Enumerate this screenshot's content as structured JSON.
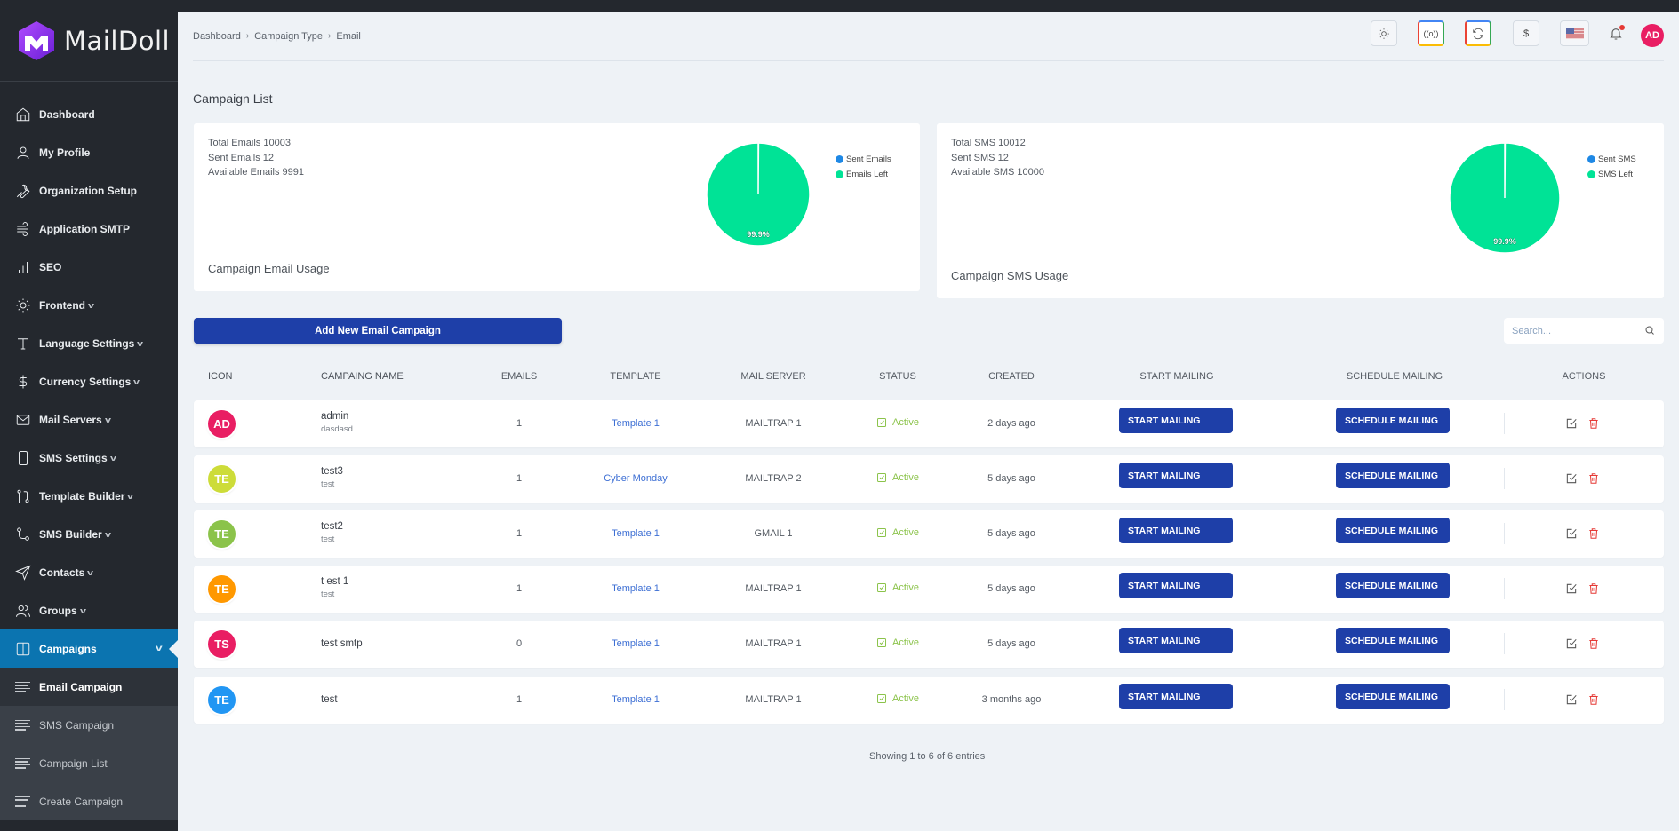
{
  "app": {
    "name": "MailDoll"
  },
  "sidebar": {
    "items": [
      {
        "label": "Dashboard",
        "icon": "home-icon",
        "has_submenu": false
      },
      {
        "label": "My Profile",
        "icon": "user-icon",
        "has_submenu": false
      },
      {
        "label": "Organization Setup",
        "icon": "wrench-icon",
        "has_submenu": false
      },
      {
        "label": "Application SMTP",
        "icon": "wind-icon",
        "has_submenu": false
      },
      {
        "label": "SEO",
        "icon": "bar-chart-icon",
        "has_submenu": false
      },
      {
        "label": "Frontend",
        "icon": "sun-icon",
        "has_submenu": true
      },
      {
        "label": "Language Settings",
        "icon": "type-icon",
        "has_submenu": true
      },
      {
        "label": "Currency Settings",
        "icon": "dollar-icon",
        "has_submenu": true
      },
      {
        "label": "Mail Servers",
        "icon": "mail-icon",
        "has_submenu": true
      },
      {
        "label": "SMS Settings",
        "icon": "phone-icon",
        "has_submenu": true
      },
      {
        "label": "Template Builder",
        "icon": "git-pull-icon",
        "has_submenu": true
      },
      {
        "label": "SMS Builder",
        "icon": "git-merge-icon",
        "has_submenu": true
      },
      {
        "label": "Contacts",
        "icon": "send-icon",
        "has_submenu": true
      },
      {
        "label": "Groups",
        "icon": "users-icon",
        "has_submenu": true
      },
      {
        "label": "Campaigns",
        "icon": "columns-icon",
        "has_submenu": true,
        "active": true
      }
    ],
    "campaign_submenu": [
      {
        "label": "Email Campaign",
        "current": true
      },
      {
        "label": "SMS Campaign"
      },
      {
        "label": "Campaign List"
      },
      {
        "label": "Create Campaign"
      }
    ]
  },
  "header": {
    "breadcrumb": [
      "Dashboard",
      "Campaign Type",
      "Email"
    ],
    "icons": [
      "theme-toggle-icon",
      "broadcast-icon",
      "refresh-icon",
      "currency-icon",
      "us-flag-icon",
      "bell-icon"
    ],
    "currency_symbol": "$",
    "user_initials": "AD",
    "notification_dot": true
  },
  "page": {
    "title": "Campaign List"
  },
  "email_card": {
    "stats": [
      "Total Emails 10003",
      "Sent Emails 12",
      "Available Emails 9991"
    ],
    "label": "Campaign Email Usage",
    "legend": [
      {
        "name": "Sent Emails",
        "color": "#1e88e5"
      },
      {
        "name": "Emails Left",
        "color": "#00e396"
      }
    ],
    "pie_label": "99.9%"
  },
  "sms_card": {
    "stats": [
      "Total SMS 10012",
      "Sent SMS 12",
      "Available SMS 10000"
    ],
    "label": "Campaign SMS Usage",
    "legend": [
      {
        "name": "Sent SMS",
        "color": "#1e88e5"
      },
      {
        "name": "SMS Left",
        "color": "#00e396"
      }
    ],
    "pie_label": "99.9%"
  },
  "chart_data": [
    {
      "type": "pie",
      "title": "Campaign Email Usage",
      "categories": [
        "Sent Emails",
        "Emails Left"
      ],
      "values": [
        12,
        9991
      ],
      "data_labels": [
        "",
        "99.9%"
      ],
      "colors": [
        "#1e88e5",
        "#00e396"
      ],
      "legend": "top-right"
    },
    {
      "type": "pie",
      "title": "Campaign SMS Usage",
      "categories": [
        "Sent SMS",
        "SMS Left"
      ],
      "values": [
        12,
        10000
      ],
      "data_labels": [
        "",
        "99.9%"
      ],
      "colors": [
        "#1e88e5",
        "#00e396"
      ],
      "legend": "top-right"
    }
  ],
  "toolbar": {
    "add_label": "Add New Email Campaign",
    "search_placeholder": "Search..."
  },
  "table": {
    "columns": [
      "ICON",
      "CAMPAING NAME",
      "EMAILS",
      "TEMPLATE",
      "MAIL SERVER",
      "STATUS",
      "CREATED",
      "START MAILING",
      "SCHEDULE MAILING",
      "ACTIONS"
    ],
    "start_label": "START MAILING",
    "schedule_label": "SCHEDULE MAILING",
    "rows": [
      {
        "initials": "AD",
        "avatar_color": "#e91e63",
        "name": "admin",
        "subtitle": "dasdasd",
        "emails": "1",
        "template": "Template 1",
        "server": "MAILTRAP 1",
        "status": "Active",
        "created": "2 days ago"
      },
      {
        "initials": "TE",
        "avatar_color": "#cddc39",
        "name": "test3",
        "subtitle": "test",
        "emails": "1",
        "template": "Cyber Monday",
        "server": "MAILTRAP 2",
        "status": "Active",
        "created": "5 days ago"
      },
      {
        "initials": "TE",
        "avatar_color": "#8bc34a",
        "name": "test2",
        "subtitle": "test",
        "emails": "1",
        "template": "Template 1",
        "server": "GMAIL 1",
        "status": "Active",
        "created": "5 days ago"
      },
      {
        "initials": "TE",
        "avatar_color": "#ff9800",
        "name": "t est 1",
        "subtitle": "test",
        "emails": "1",
        "template": "Template 1",
        "server": "MAILTRAP 1",
        "status": "Active",
        "created": "5 days ago"
      },
      {
        "initials": "TS",
        "avatar_color": "#e91e63",
        "name": "test smtp",
        "subtitle": "",
        "emails": "0",
        "template": "Template 1",
        "server": "MAILTRAP 1",
        "status": "Active",
        "created": "5 days ago"
      },
      {
        "initials": "TE",
        "avatar_color": "#2196f3",
        "name": "test",
        "subtitle": "",
        "emails": "1",
        "template": "Template 1",
        "server": "MAILTRAP 1",
        "status": "Active",
        "created": "3 months ago"
      }
    ],
    "footer": "Showing 1 to 6 of 6 entries"
  }
}
